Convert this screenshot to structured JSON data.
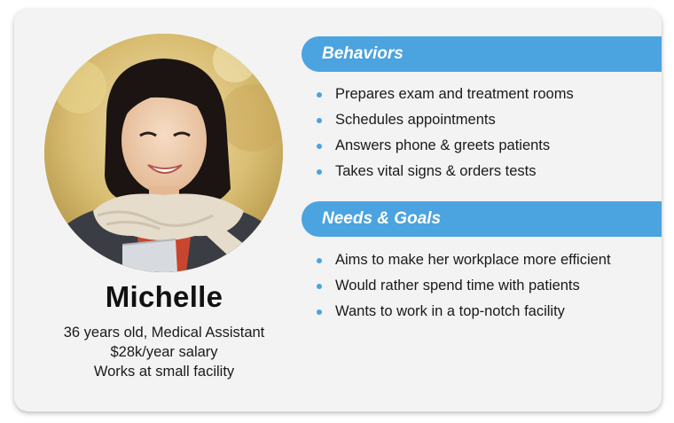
{
  "persona": {
    "name": "Michelle",
    "details": [
      "36 years old, Medical Assistant",
      "$28k/year salary",
      "Works at small facility"
    ]
  },
  "behaviors": {
    "title": "Behaviors",
    "items": [
      "Prepares exam and treatment rooms",
      "Schedules appointments",
      "Answers phone & greets patients",
      "Takes vital signs & orders tests"
    ]
  },
  "needs_goals": {
    "title": "Needs & Goals",
    "items": [
      "Aims to make her workplace more efficient",
      "Would rather spend time with patients",
      "Wants to work in a top-notch facility"
    ]
  },
  "colors": {
    "accent": "#4ba3df",
    "card_bg": "#f3f3f3",
    "text": "#1a1a1a"
  }
}
